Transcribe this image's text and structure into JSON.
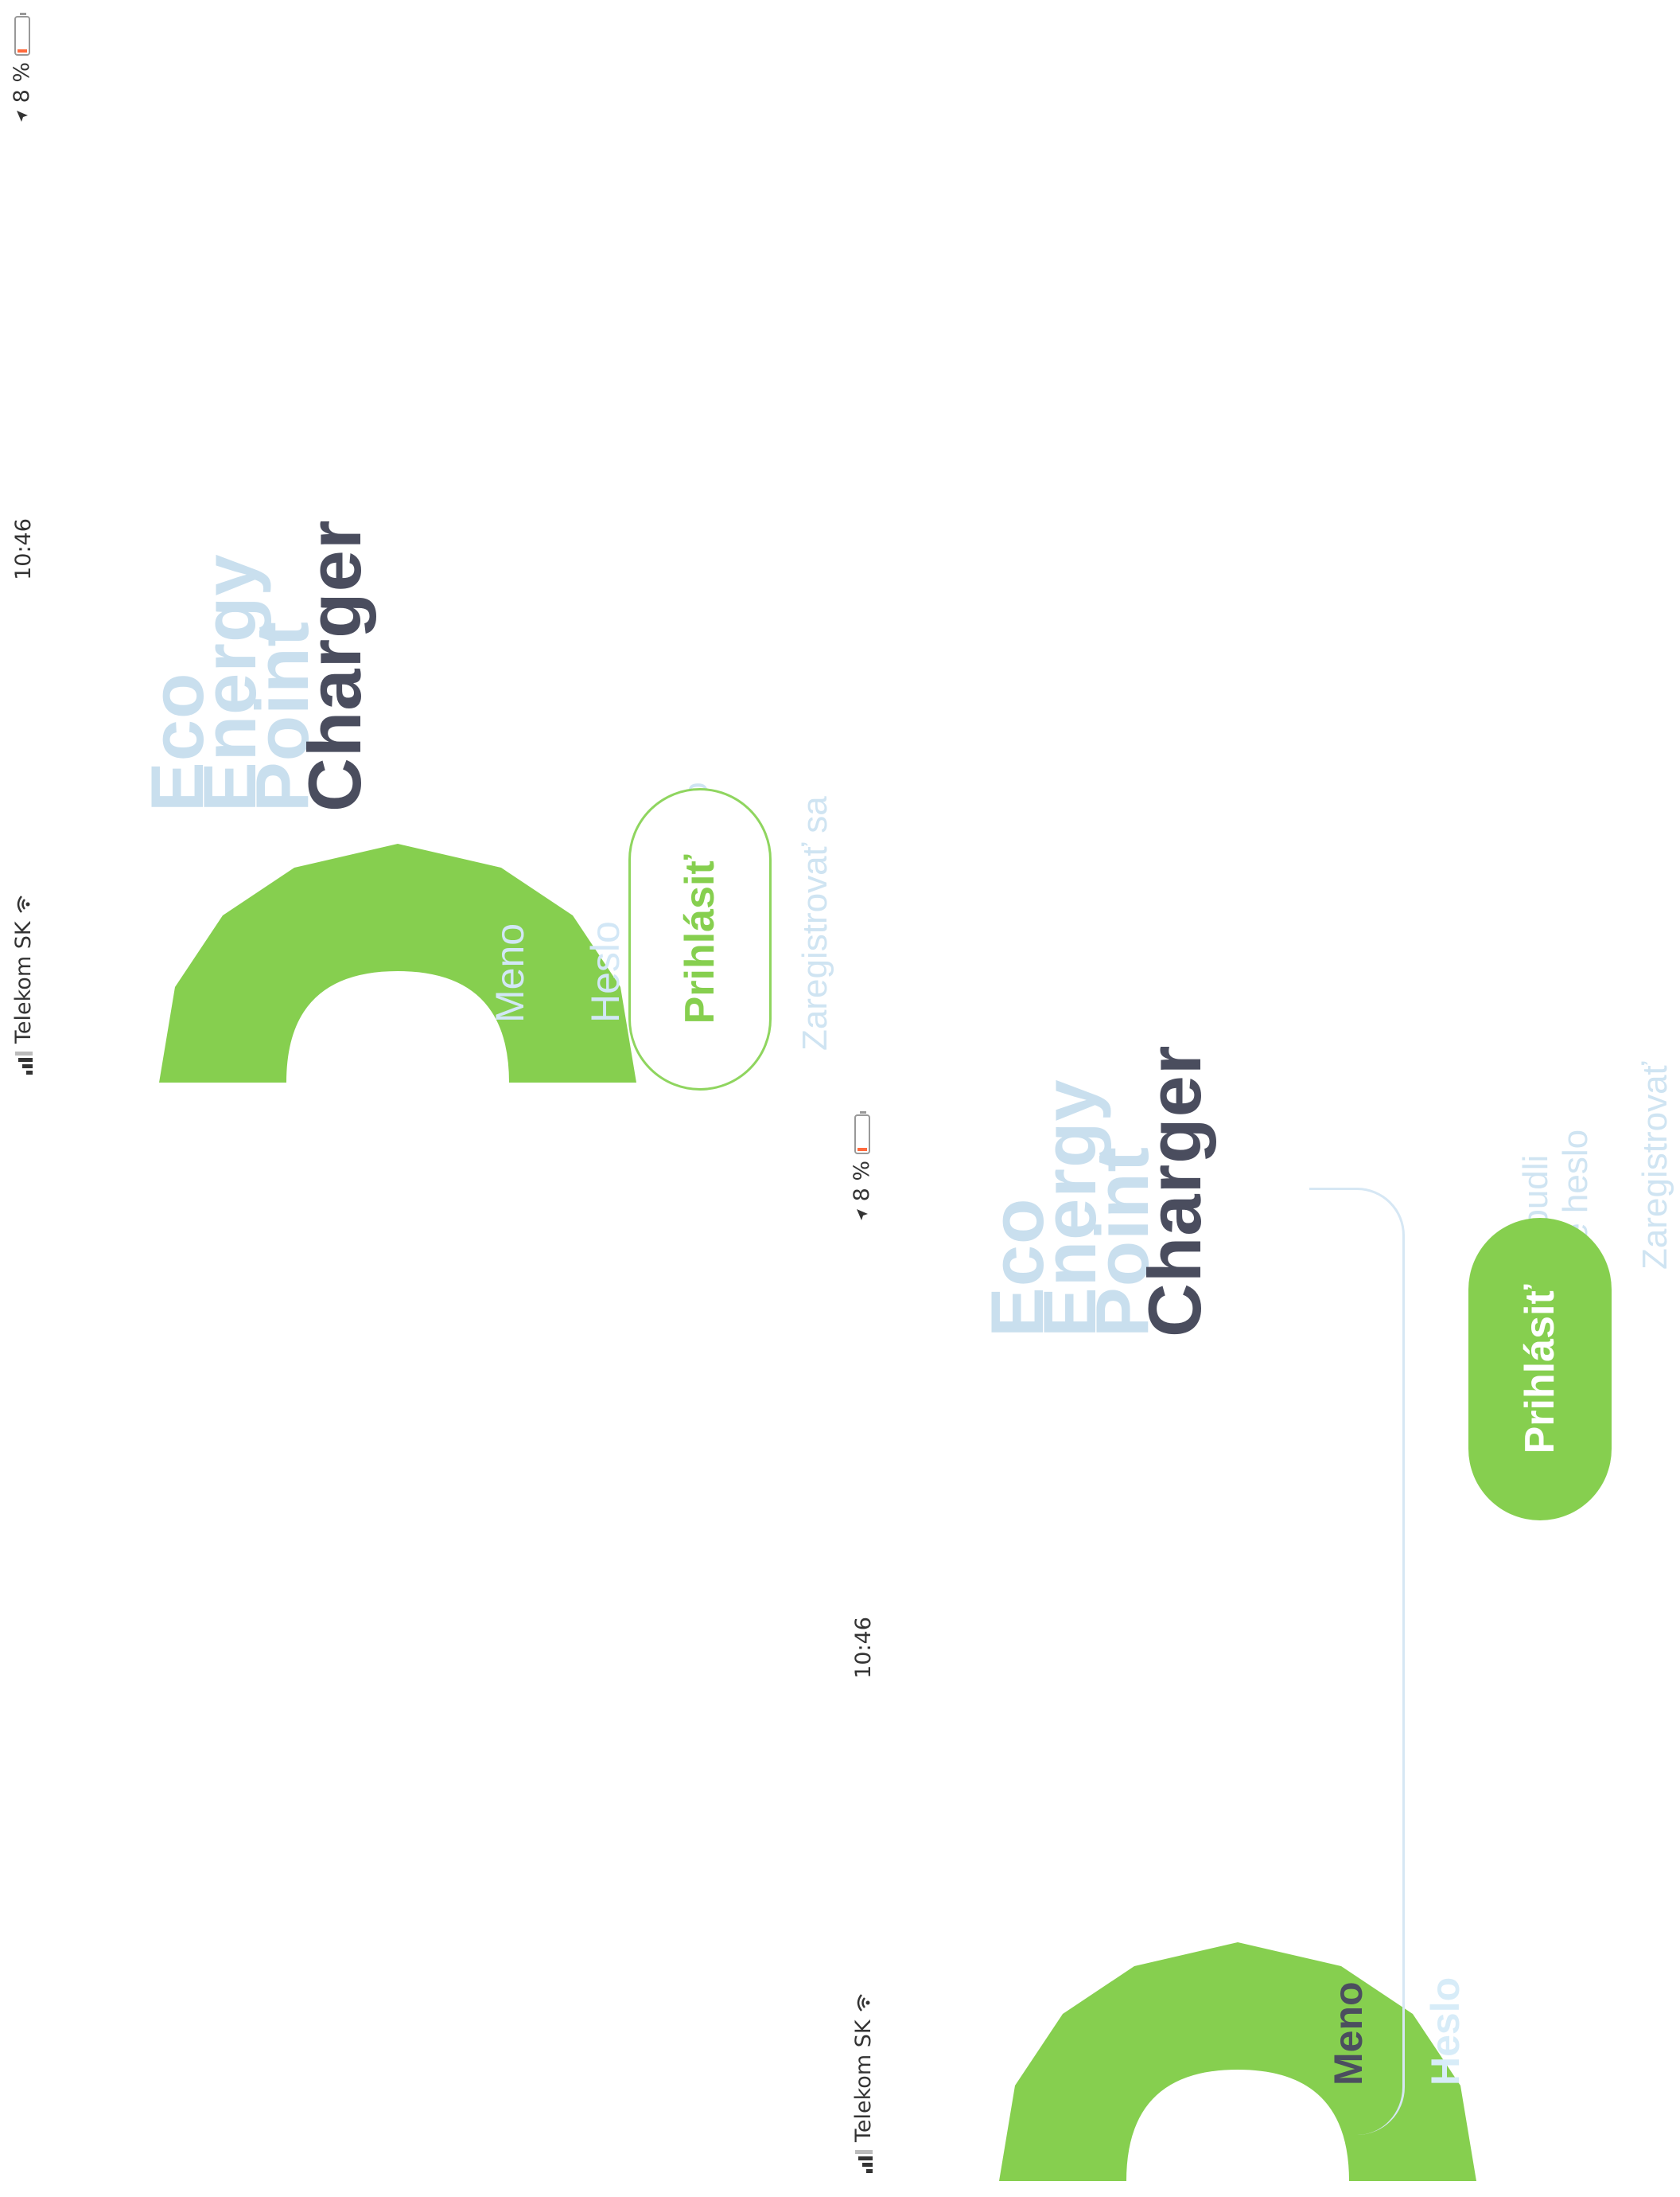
{
  "status_bar": {
    "carrier": "Telekom SK",
    "time": "10:46",
    "battery_text": "8 %"
  },
  "brand": {
    "line1": "Eco",
    "line2": "Energy",
    "line3": "Point",
    "line4": "Charger"
  },
  "form": {
    "username_label": "Meno",
    "password_label": "Heslo",
    "forgot_password": "Zabudli ste heslo",
    "login_button": "Prihlásiť",
    "register_link": "Zaregistrovať sa"
  },
  "colors": {
    "accent_green": "#86cf4f",
    "brand_light": "#c9dfee",
    "brand_dark": "#4a4d5e",
    "battery_low": "#ff6a3d"
  },
  "battery_level": 0.08
}
